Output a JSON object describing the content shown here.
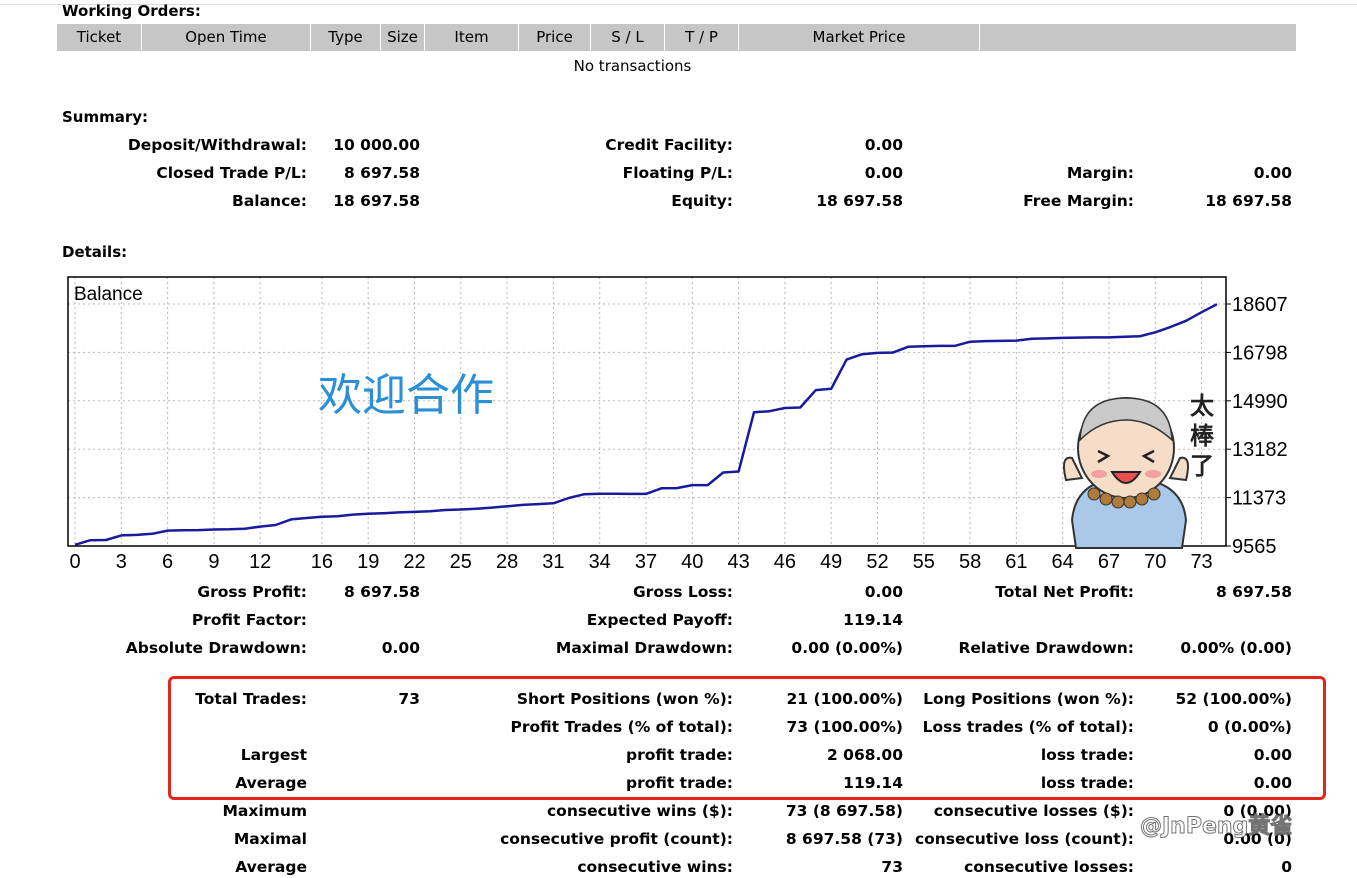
{
  "working_orders": {
    "title": "Working Orders:",
    "columns": [
      "Ticket",
      "Open Time",
      "Type",
      "Size",
      "Item",
      "Price",
      "S / L",
      "T / P",
      "Market Price",
      ""
    ],
    "empty_text": "No transactions"
  },
  "summary": {
    "title": "Summary:",
    "deposit_label": "Deposit/Withdrawal:",
    "deposit_value": "10 000.00",
    "credit_label": "Credit Facility:",
    "credit_value": "0.00",
    "closed_label": "Closed Trade P/L:",
    "closed_value": "8 697.58",
    "floating_label": "Floating P/L:",
    "floating_value": "0.00",
    "margin_label": "Margin:",
    "margin_value": "0.00",
    "balance_label": "Balance:",
    "balance_value": "18 697.58",
    "equity_label": "Equity:",
    "equity_value": "18 697.58",
    "free_margin_label": "Free Margin:",
    "free_margin_value": "18 697.58"
  },
  "details": {
    "title": "Details:",
    "overlay_text": "欢迎合作",
    "sticker_text": "太棒了"
  },
  "chart_data": {
    "type": "line",
    "title": "Balance",
    "xlabel": "",
    "ylabel": "",
    "x_ticks": [
      "0",
      "3",
      "6",
      "9",
      "12",
      "16",
      "19",
      "22",
      "25",
      "28",
      "31",
      "34",
      "37",
      "40",
      "43",
      "46",
      "49",
      "52",
      "55",
      "58",
      "61",
      "64",
      "67",
      "70",
      "73"
    ],
    "y_ticks": [
      "18607",
      "16798",
      "14990",
      "13182",
      "11373",
      "9565"
    ],
    "ylim": [
      9565,
      18607
    ],
    "xlim": [
      0,
      74
    ],
    "grid": true,
    "color": "#1a1a9c",
    "series": [
      {
        "x": [
          0,
          1,
          2,
          3,
          4,
          5,
          6,
          7,
          8,
          9,
          10,
          11,
          12,
          13,
          14,
          15,
          16,
          17,
          18,
          19,
          20,
          21,
          22,
          23,
          24,
          25,
          26,
          27,
          28,
          29,
          30,
          31,
          32,
          33,
          34,
          35,
          36,
          37,
          38,
          39,
          40,
          41,
          42,
          43,
          44,
          45,
          46,
          47,
          48,
          49,
          50,
          51,
          52,
          53,
          54,
          55,
          56,
          57,
          58,
          59,
          60,
          61,
          62,
          63,
          64,
          65,
          66,
          67,
          68,
          69,
          70,
          71,
          72,
          73,
          74
        ],
        "values": [
          9610,
          9780,
          9790,
          9960,
          9980,
          10020,
          10140,
          10150,
          10160,
          10180,
          10190,
          10210,
          10290,
          10350,
          10560,
          10610,
          10660,
          10680,
          10740,
          10770,
          10790,
          10820,
          10840,
          10860,
          10910,
          10930,
          10960,
          11000,
          11050,
          11100,
          11130,
          11160,
          11360,
          11500,
          11520,
          11520,
          11510,
          11510,
          11720,
          11730,
          11840,
          11840,
          12310,
          12350,
          14560,
          14600,
          14720,
          14740,
          15390,
          15440,
          16530,
          16730,
          16780,
          16790,
          17010,
          17030,
          17040,
          17040,
          17200,
          17220,
          17230,
          17240,
          17310,
          17320,
          17340,
          17350,
          17360,
          17360,
          17380,
          17400,
          17550,
          17750,
          17980,
          18300,
          18600
        ]
      }
    ]
  },
  "stats": {
    "gross_profit_label": "Gross Profit:",
    "gross_profit_value": "8 697.58",
    "gross_loss_label": "Gross Loss:",
    "gross_loss_value": "0.00",
    "total_net_label": "Total Net Profit:",
    "total_net_value": "8 697.58",
    "profit_factor_label": "Profit Factor:",
    "expected_payoff_label": "Expected Payoff:",
    "expected_payoff_value": "119.14",
    "abs_dd_label": "Absolute Drawdown:",
    "abs_dd_value": "0.00",
    "max_dd_label": "Maximal Drawdown:",
    "max_dd_value": "0.00 (0.00%)",
    "rel_dd_label": "Relative Drawdown:",
    "rel_dd_value": "0.00% (0.00)",
    "total_trades_label": "Total Trades:",
    "total_trades_value": "73",
    "short_label": "Short Positions (won %):",
    "short_value": "21 (100.00%)",
    "long_label": "Long Positions (won %):",
    "long_value": "52 (100.00%)",
    "profit_trades_label": "Profit Trades (% of total):",
    "profit_trades_value": "73 (100.00%)",
    "loss_trades_label": "Loss trades (% of total):",
    "loss_trades_value": "0 (0.00%)",
    "largest_label": "Largest",
    "largest_profit_label": "profit trade:",
    "largest_profit_value": "2 068.00",
    "largest_loss_label": "loss trade:",
    "largest_loss_value": "0.00",
    "average_label": "Average",
    "average_profit_label": "profit trade:",
    "average_profit_value": "119.14",
    "average_loss_label": "loss trade:",
    "average_loss_value": "0.00",
    "maximum_label": "Maximum",
    "cons_wins_label": "consecutive wins ($):",
    "cons_wins_value": "73 (8 697.58)",
    "cons_losses_label": "consecutive losses ($):",
    "cons_losses_value": "0 (0.00)",
    "maximal_label": "Maximal",
    "cons_profit_label": "consecutive profit (count):",
    "cons_profit_value": "8 697.58 (73)",
    "cons_loss_label": "consecutive loss (count):",
    "cons_loss_value": "0.00 (0)",
    "average2_label": "Average",
    "avg_cons_wins_label": "consecutive wins:",
    "avg_cons_wins_value": "73",
    "avg_cons_losses_label": "consecutive losses:",
    "avg_cons_losses_value": "0"
  },
  "watermark": "@JnPeng黄雀"
}
